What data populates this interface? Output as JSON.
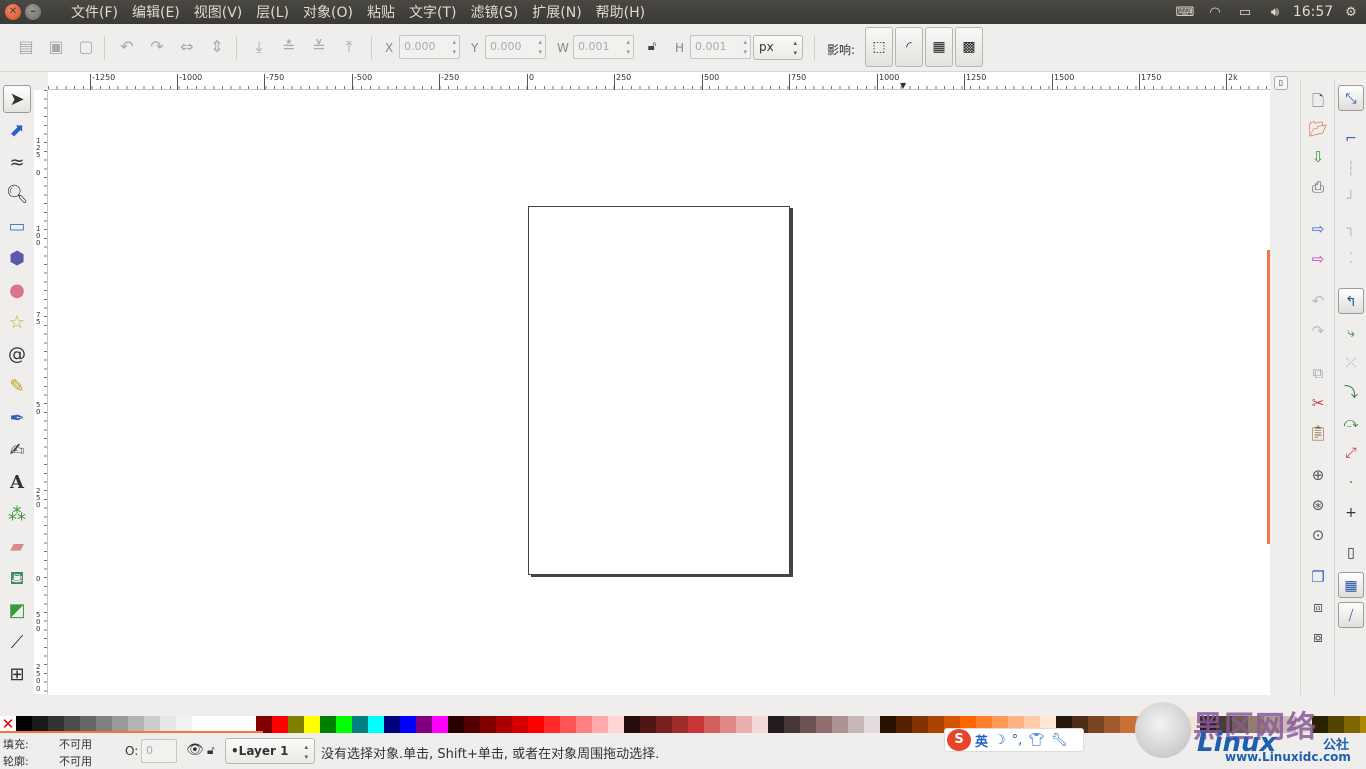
{
  "menu": [
    "文件(F)",
    "编辑(E)",
    "视图(V)",
    "层(L)",
    "对象(O)",
    "粘贴",
    "文字(T)",
    "滤镜(S)",
    "扩展(N)",
    "帮助(H)"
  ],
  "tray": {
    "clock": "16:57"
  },
  "toolbar": {
    "x_label": "X",
    "x_value": "0.000",
    "y_label": "Y",
    "y_value": "0.000",
    "w_label": "W",
    "w_value": "0.001",
    "h_label": "H",
    "h_value": "0.001",
    "unit": "px",
    "affect_label": "影响:"
  },
  "ruler_h": [
    "-1250",
    "-1000",
    "-750",
    "-500",
    "-250",
    "0",
    "250",
    "500",
    "750",
    "1000",
    "1250",
    "1500",
    "1750",
    "2k"
  ],
  "ruler_v": [
    "125",
    "0",
    "100",
    "75",
    "50",
    "250",
    "0",
    "500",
    "250",
    "0"
  ],
  "status": {
    "fill_label": "填充:",
    "fill_value": "不可用",
    "stroke_label": "轮廓:",
    "stroke_value": "不可用",
    "opacity_label": "O:",
    "opacity_value": "0",
    "layer": "•Layer 1",
    "message": "没有选择对象.单击, Shift+单击, 或者在对象周围拖动选择."
  },
  "ime": {
    "lang": "英",
    "logo": "S"
  },
  "watermark": {
    "big": "黑区网络",
    "brand": "Linux",
    "brand2": "公社",
    "url": "www.Linuxidc.com"
  },
  "palette": [
    "#000000",
    "#1a1a1a",
    "#333333",
    "#4d4d4d",
    "#666666",
    "#808080",
    "#999999",
    "#b3b3b3",
    "#cccccc",
    "#e6e6e6",
    "#f2f2f2",
    "#ffffff",
    "#ffffff",
    "#ffffff",
    "#ffffff",
    "#800000",
    "#ff0000",
    "#808000",
    "#ffff00",
    "#008000",
    "#00ff00",
    "#008080",
    "#00ffff",
    "#000080",
    "#0000ff",
    "#800080",
    "#ff00ff",
    "#2b0000",
    "#550000",
    "#800000",
    "#aa0000",
    "#d40000",
    "#ff0000",
    "#ff2a2a",
    "#ff5555",
    "#ff8080",
    "#ffaaaa",
    "#ffd5d5",
    "#280b0b",
    "#501616",
    "#782121",
    "#a02c2c",
    "#c83737",
    "#d35f5f",
    "#de8787",
    "#e9afaf",
    "#f4d7d7",
    "#241c1c",
    "#483737",
    "#6c5353",
    "#916f6f",
    "#ac9393",
    "#c8b7b7",
    "#e3dbdb",
    "#2b1100",
    "#552200",
    "#803300",
    "#aa4400",
    "#d45500",
    "#ff6600",
    "#ff7f2a",
    "#ff9955",
    "#ffb380",
    "#ffccaa",
    "#ffe6d5",
    "#28170b",
    "#502d16",
    "#784421",
    "#a05a2c",
    "#c87137",
    "#d38d5f",
    "#deaa87",
    "#e9c6af",
    "#f4e3d7",
    "#241f1c",
    "#483e37",
    "#6c5d53",
    "#917c6f",
    "#ac9d93",
    "#c8beb7",
    "#e3dedb",
    "#2b2200",
    "#554400",
    "#806600",
    "#aa8800",
    "#d4aa00",
    "#ffcc00"
  ]
}
